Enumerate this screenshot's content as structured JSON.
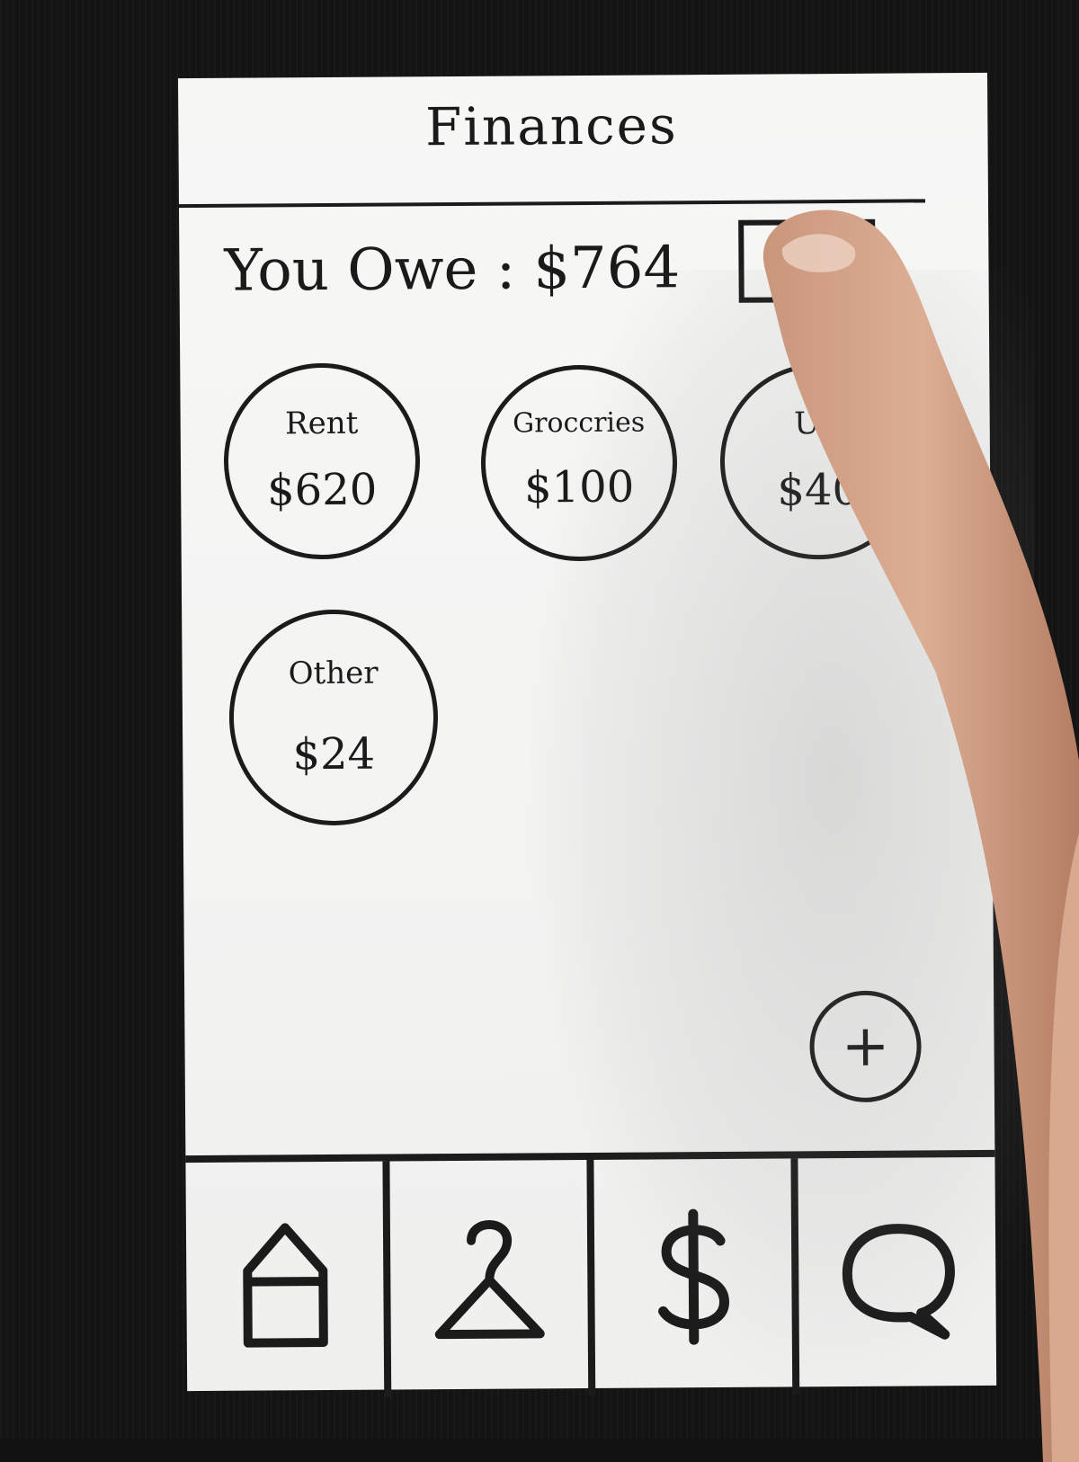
{
  "header": {
    "title": "Finances"
  },
  "summary": {
    "owe_label": "You Owe :",
    "owe_amount": "$764"
  },
  "categories": [
    {
      "name": "Rent",
      "amount": "$620"
    },
    {
      "name": "Groccries",
      "amount": "$100"
    },
    {
      "name": "Uti",
      "amount": "$40"
    },
    {
      "name": "Other",
      "amount": "$24"
    }
  ],
  "add_button": {
    "icon": "plus-icon",
    "symbol": "+"
  },
  "bottom_nav": [
    {
      "icon": "home-icon"
    },
    {
      "icon": "hanger-icon"
    },
    {
      "icon": "dollar-icon"
    },
    {
      "icon": "chat-bubble-icon"
    }
  ],
  "colors": {
    "ink": "#1b1b1b",
    "paper": "#f5f5f4",
    "background": "#141414"
  }
}
